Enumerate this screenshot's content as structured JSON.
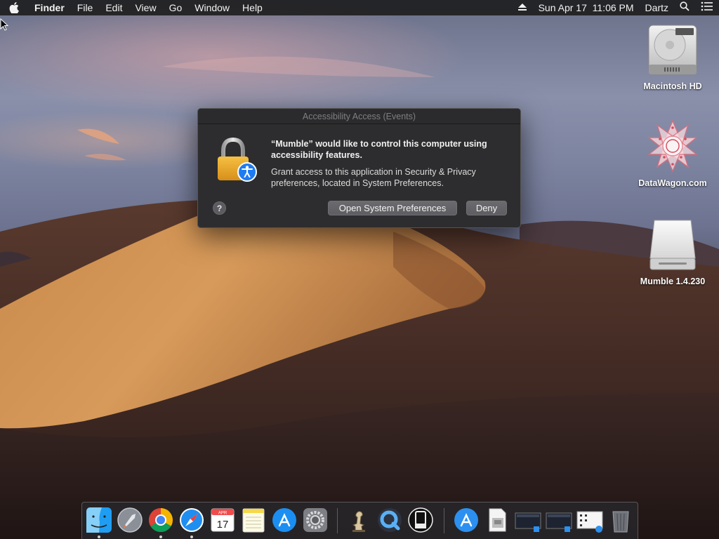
{
  "menubar": {
    "app_name": "Finder",
    "items": [
      "File",
      "Edit",
      "View",
      "Go",
      "Window",
      "Help"
    ],
    "clock": "Sun Apr 17  11:06 PM",
    "user": "Dartz"
  },
  "desktop": {
    "icons": [
      {
        "label": "Macintosh HD",
        "icon": "hard-drive-icon"
      },
      {
        "label": "DataWagon.com",
        "icon": "datawagon-icon"
      },
      {
        "label": "Mumble 1.4.230",
        "icon": "disk-image-icon"
      }
    ]
  },
  "dialog": {
    "title": "Accessibility Access (Events)",
    "headline": "“Mumble” would like to control this computer using accessibility features.",
    "body": "Grant access to this application in Security & Privacy preferences, located in System Preferences.",
    "help_label": "?",
    "open_button": "Open System Preferences",
    "deny_button": "Deny"
  },
  "dock": {
    "calendar_month": "APR",
    "calendar_day": "17",
    "items": [
      "finder-icon",
      "launchpad-icon",
      "chrome-icon",
      "safari-icon",
      "calendar-icon",
      "notes-icon",
      "app-store-icon",
      "system-preferences-icon",
      "chess-icon",
      "quicktime-icon",
      "ble-icon",
      "app-store-folder-icon",
      "preview-document-icon",
      "screenshot-icon",
      "screenshot-icon-2",
      "network-diagram-icon",
      "trash-icon"
    ]
  },
  "colors": {
    "dialog_bg": "#2d2d2f",
    "button_bg": "#656569",
    "menubar_bg": "#1e1e20"
  }
}
